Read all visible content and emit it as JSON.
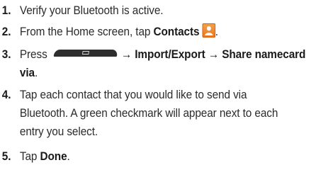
{
  "steps": [
    {
      "number": "1.",
      "text": "Verify your Bluetooth is active."
    },
    {
      "number": "2.",
      "prefix": "From the Home screen, tap ",
      "bold": "Contacts",
      "suffix": "."
    },
    {
      "number": "3.",
      "prefix": "Press",
      "bold_line1": "→ Import/Export → Share namecard",
      "bold_line2": "via",
      "suffix": "."
    },
    {
      "number": "4.",
      "line1": "Tap each contact that you would like to send via",
      "line2": "Bluetooth. A green checkmark will appear next to each",
      "line3": "entry you select."
    },
    {
      "number": "5.",
      "prefix": "Tap ",
      "bold": "Done",
      "suffix": "."
    }
  ],
  "icons": {
    "contacts": "contacts-app-icon",
    "menu_key": "menu-key-icon"
  },
  "colors": {
    "contacts_icon": "#ee8424",
    "menu_key": "#2e2e2e"
  }
}
